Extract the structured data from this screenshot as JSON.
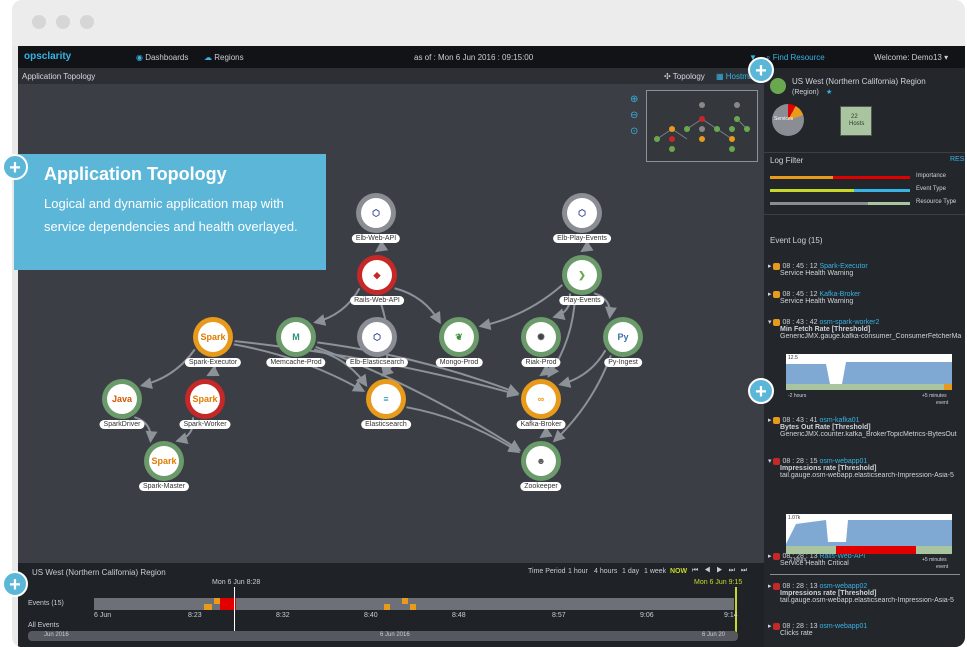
{
  "app": {
    "logo": "opsclarity",
    "nav_dashboards": "Dashboards",
    "nav_regions": "Regions",
    "as_of": "as of : Mon 6 Jun 2016 : 09:15:00",
    "find_resource": "Find Resource",
    "welcome": "Welcome: Demo13 ▾"
  },
  "main": {
    "title": "Application Topology",
    "view_topology": "Topology",
    "view_hostmap": "Hostmap"
  },
  "callout": {
    "title": "Application Topology",
    "body": "Logical and dynamic application map with service dependencies and health overlayed."
  },
  "nodes": [
    {
      "id": "elb-web-api",
      "label": "Elb-Web-API",
      "icon": "network-hub-icon",
      "ring": "#8a8d93",
      "glyph": "⬡",
      "color": "#2d3f8f"
    },
    {
      "id": "elb-play-events",
      "label": "Elb-Play-Events",
      "icon": "network-hub-icon",
      "ring": "#8a8d93",
      "glyph": "⬡",
      "color": "#2d3f8f"
    },
    {
      "id": "rails-web-api",
      "label": "Rails-Web-API",
      "icon": "rails-icon",
      "ring": "#c62828",
      "glyph": "◆",
      "color": "#c62828"
    },
    {
      "id": "play-events",
      "label": "Play-Events",
      "icon": "play-icon",
      "ring": "#6b9a6b",
      "glyph": "❯",
      "color": "#6aa84f"
    },
    {
      "id": "spark-executor",
      "label": "Spark-Executor",
      "icon": "spark-icon",
      "ring": "#e89a1b",
      "glyph": "Spark",
      "color": "#e07b00"
    },
    {
      "id": "memcache-prod",
      "label": "Memcache-Prod",
      "icon": "memcache-icon",
      "ring": "#6b9a6b",
      "glyph": "M",
      "color": "#2f8f7a"
    },
    {
      "id": "elb-elasticsearch",
      "label": "Elb-Elasticsearch",
      "icon": "network-hub-icon",
      "ring": "#8a8d93",
      "glyph": "⬡",
      "color": "#2d3f8f"
    },
    {
      "id": "mongo-prod",
      "label": "Mongo-Prod",
      "icon": "mongo-leaf-icon",
      "ring": "#6b9a6b",
      "glyph": "❦",
      "color": "#3f8f3f"
    },
    {
      "id": "riak-prod",
      "label": "Riak-Prod",
      "icon": "riak-icon",
      "ring": "#6b9a6b",
      "glyph": "✺",
      "color": "#444"
    },
    {
      "id": "py-ingest",
      "label": "Py-Ingest",
      "icon": "python-icon",
      "ring": "#6b9a6b",
      "glyph": "Py",
      "color": "#3a6fa8"
    },
    {
      "id": "spark-driver",
      "label": "SparkDriver",
      "icon": "java-icon",
      "ring": "#6b9a6b",
      "glyph": "Java",
      "color": "#d35400"
    },
    {
      "id": "spark-worker",
      "label": "Spark-Worker",
      "icon": "spark-icon",
      "ring": "#c62828",
      "glyph": "Spark",
      "color": "#e07b00"
    },
    {
      "id": "elasticsearch",
      "label": "Elasticsearch",
      "icon": "elasticsearch-icon",
      "ring": "#e89a1b",
      "glyph": "≡",
      "color": "#1a8fb8"
    },
    {
      "id": "kafka-broker",
      "label": "Kafka-Broker",
      "icon": "kafka-icon",
      "ring": "#e89a1b",
      "glyph": "∞",
      "color": "#e89a1b"
    },
    {
      "id": "spark-master",
      "label": "Spark-Master",
      "icon": "spark-icon",
      "ring": "#6b9a6b",
      "glyph": "Spark",
      "color": "#e07b00"
    },
    {
      "id": "zookeeper",
      "label": "Zookeeper",
      "icon": "zookeeper-icon",
      "ring": "#6b9a6b",
      "glyph": "☻",
      "color": "#555"
    }
  ],
  "right": {
    "region": "US West (Northern California) Region",
    "region_sub": "(Region)",
    "services": "Services",
    "hosts_count": "22",
    "hosts": "Hosts",
    "log_filter": "Log Filter",
    "reset": "RES",
    "importance": "Importance",
    "event_type": "Event Type",
    "resource_type": "Resource Type",
    "event_log": "Event Log (15)",
    "events": [
      {
        "time": "08 : 45 : 12",
        "source": "Spark-Executor",
        "desc": "Service Health Warning",
        "color": "#e89a1b"
      },
      {
        "time": "08 : 45 : 12",
        "source": "Kafka-Broker",
        "desc": "Service Health Warning",
        "color": "#e89a1b"
      },
      {
        "time": "08 : 43 : 42",
        "source": "osm-spark-worker2",
        "desc": "Min Fetch Rate [Threshold]",
        "detail": "GenericJMX.gauge.kafka-consumer_ConsumerFetcherMa",
        "color": "#e89a1b"
      },
      {
        "time": "08 : 43 : 41",
        "source": "osm-kafka01",
        "desc": "Bytes Out Rate [Threshold]",
        "detail": "GenericJMX.counter.kafka_BrokerTopicMetrics-BytesOut",
        "color": "#e89a1b"
      },
      {
        "time": "08 : 28 : 15",
        "source": "osm-webapp01",
        "desc": "Impressions rate [Threshold]",
        "detail": "tail.gauge.osm-webapp.elasticsearch-Impression-Asia-5",
        "color": "#c62828"
      },
      {
        "time": "08 : 28 : 13",
        "source": "Rails-Web-API",
        "desc": "Service Health Critical",
        "color": "#c62828"
      },
      {
        "time": "08 : 28 : 13",
        "source": "osm-webapp02",
        "desc": "Impressions rate [Threshold]",
        "detail": "tail.gauge.osm-webapp.elasticsearch-Impression-Asia-5",
        "color": "#c62828"
      },
      {
        "time": "08 : 28 : 13",
        "source": "osm-webapp01",
        "desc": "Clicks rate",
        "color": "#c62828"
      }
    ],
    "chart1_y": "12.5",
    "chart1_x1": "-2 hours",
    "chart1_x2": "+5 minutes",
    "chart1_x3": "event",
    "chart2_y": "1.07k",
    "chart2_x1": "-2 hours",
    "chart2_x2": "+5 minutes",
    "chart2_x3": "event"
  },
  "timeline": {
    "region": "US West (Northern California) Region",
    "time_period": "Time Period",
    "p1": "1 hour",
    "p2": "4 hours",
    "p3": "1 day",
    "p4": "1 week",
    "now": "NOW",
    "marker": "Mon 6 Jun 8:28",
    "marker_end": "Mon 6 Jun 9:15",
    "events_label": "Events (15)",
    "all_events": "All Events",
    "ticks": [
      "6 Jun",
      "8:23",
      "8:32",
      "8:40",
      "8:48",
      "8:57",
      "9:06",
      "9:14"
    ],
    "range_start": "Jun 2016",
    "range_mid": "6 Jun 2016",
    "range_end": "6 Jun 20"
  }
}
